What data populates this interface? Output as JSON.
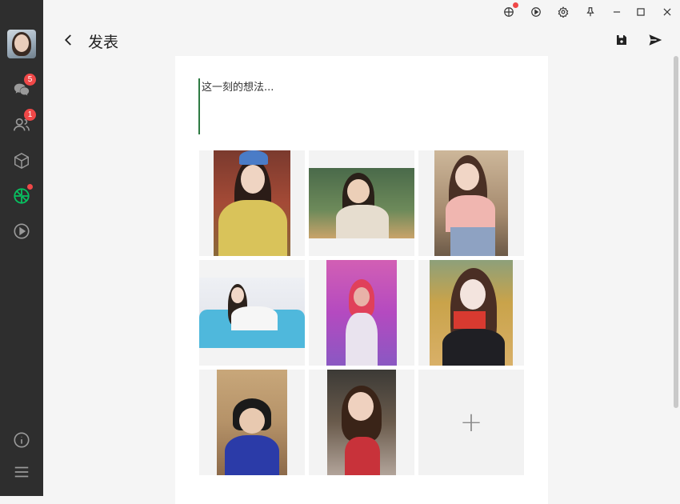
{
  "app": {
    "title": "发表",
    "placeholder": "这一刻的想法..."
  },
  "sidebar": {
    "items": [
      {
        "name": "chats",
        "icon": "chat-icon",
        "badge": "5"
      },
      {
        "name": "contacts",
        "icon": "contacts-icon",
        "badge": "1"
      },
      {
        "name": "mini-programs",
        "icon": "cube-icon",
        "badge": ""
      },
      {
        "name": "moments",
        "icon": "moments-icon",
        "dot": true
      },
      {
        "name": "channels",
        "icon": "play-circle-icon",
        "badge": ""
      }
    ]
  },
  "photos": [
    {
      "name": "photo-1"
    },
    {
      "name": "photo-2"
    },
    {
      "name": "photo-3"
    },
    {
      "name": "photo-4"
    },
    {
      "name": "photo-5"
    },
    {
      "name": "photo-6"
    },
    {
      "name": "photo-7"
    },
    {
      "name": "photo-8"
    }
  ],
  "add_label": "+",
  "colors": {
    "sidebar": "#2e2e2e",
    "accent": "#07c160",
    "badge": "#f04848"
  }
}
